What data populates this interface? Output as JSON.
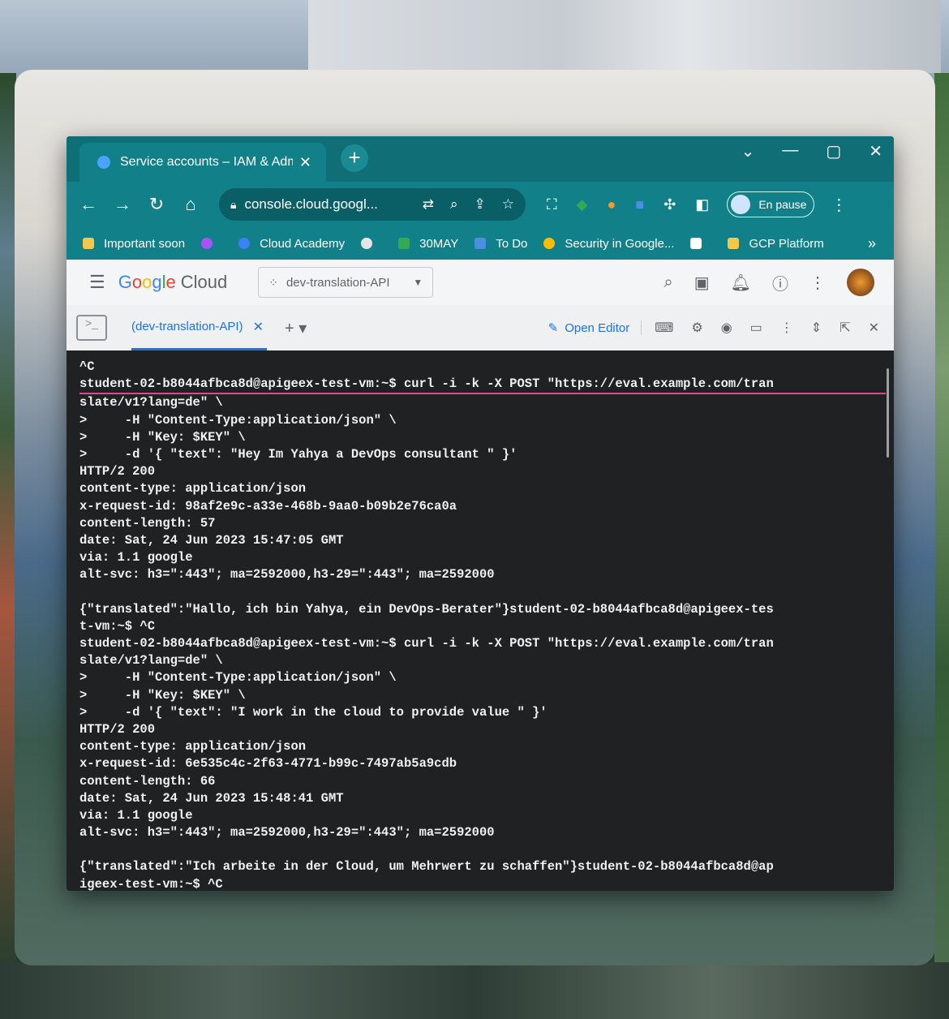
{
  "browser": {
    "tab_title": "Service accounts – IAM & Adm",
    "tab_close": "✕",
    "new_tab": "+",
    "window_controls": [
      "⌄",
      "—",
      "▢",
      "✕"
    ],
    "url": "console.cloud.googl...",
    "profile_status": "En pause",
    "bookmarks": [
      {
        "label": "Important soon",
        "color": "#f2c94c"
      },
      {
        "label": "Cloud Academy",
        "color": "#3b82f6"
      },
      {
        "label": "30MAY",
        "color": "#34a853"
      },
      {
        "label": "To Do",
        "color": "#4a90e2"
      },
      {
        "label": "Security in Google...",
        "color": "#fbbc05"
      },
      {
        "label": "GCP Platform",
        "color": "#f2c94c"
      }
    ],
    "bookmarks_more": "»"
  },
  "gcp": {
    "logo_cloud": "Cloud",
    "project": "dev-translation-API"
  },
  "shell": {
    "tab_label": "(dev-translation-API)",
    "tab_close": "✕",
    "add_tab": "+ ▾",
    "open_editor": "Open Editor"
  },
  "terminal": {
    "lines": [
      "^C",
      "student-02-b8044afbca8d@apigeex-test-vm:~$ curl -i -k -X POST \"https://eval.example.com/tran",
      "slate/v1?lang=de\" \\",
      ">     -H \"Content-Type:application/json\" \\",
      ">     -H \"Key: $KEY\" \\",
      ">     -d '{ \"text\": \"Hey Im Yahya a DevOps consultant \" }'",
      "HTTP/2 200",
      "content-type: application/json",
      "x-request-id: 98af2e9c-a33e-468b-9aa0-b09b2e76ca0a",
      "content-length: 57",
      "date: Sat, 24 Jun 2023 15:47:05 GMT",
      "via: 1.1 google",
      "alt-svc: h3=\":443\"; ma=2592000,h3-29=\":443\"; ma=2592000",
      "",
      "{\"translated\":\"Hallo, ich bin Yahya, ein DevOps-Berater\"}student-02-b8044afbca8d@apigeex-tes",
      "t-vm:~$ ^C",
      "student-02-b8044afbca8d@apigeex-test-vm:~$ curl -i -k -X POST \"https://eval.example.com/tran",
      "slate/v1?lang=de\" \\",
      ">     -H \"Content-Type:application/json\" \\",
      ">     -H \"Key: $KEY\" \\",
      ">     -d '{ \"text\": \"I work in the cloud to provide value \" }'",
      "HTTP/2 200",
      "content-type: application/json",
      "x-request-id: 6e535c4c-2f63-4771-b99c-7497ab5a9cdb",
      "content-length: 66",
      "date: Sat, 24 Jun 2023 15:48:41 GMT",
      "via: 1.1 google",
      "alt-svc: h3=\":443\"; ma=2592000,h3-29=\":443\"; ma=2592000",
      "",
      "{\"translated\":\"Ich arbeite in der Cloud, um Mehrwert zu schaffen\"}student-02-b8044afbca8d@ap",
      "igeex-test-vm:~$ ^C"
    ]
  }
}
